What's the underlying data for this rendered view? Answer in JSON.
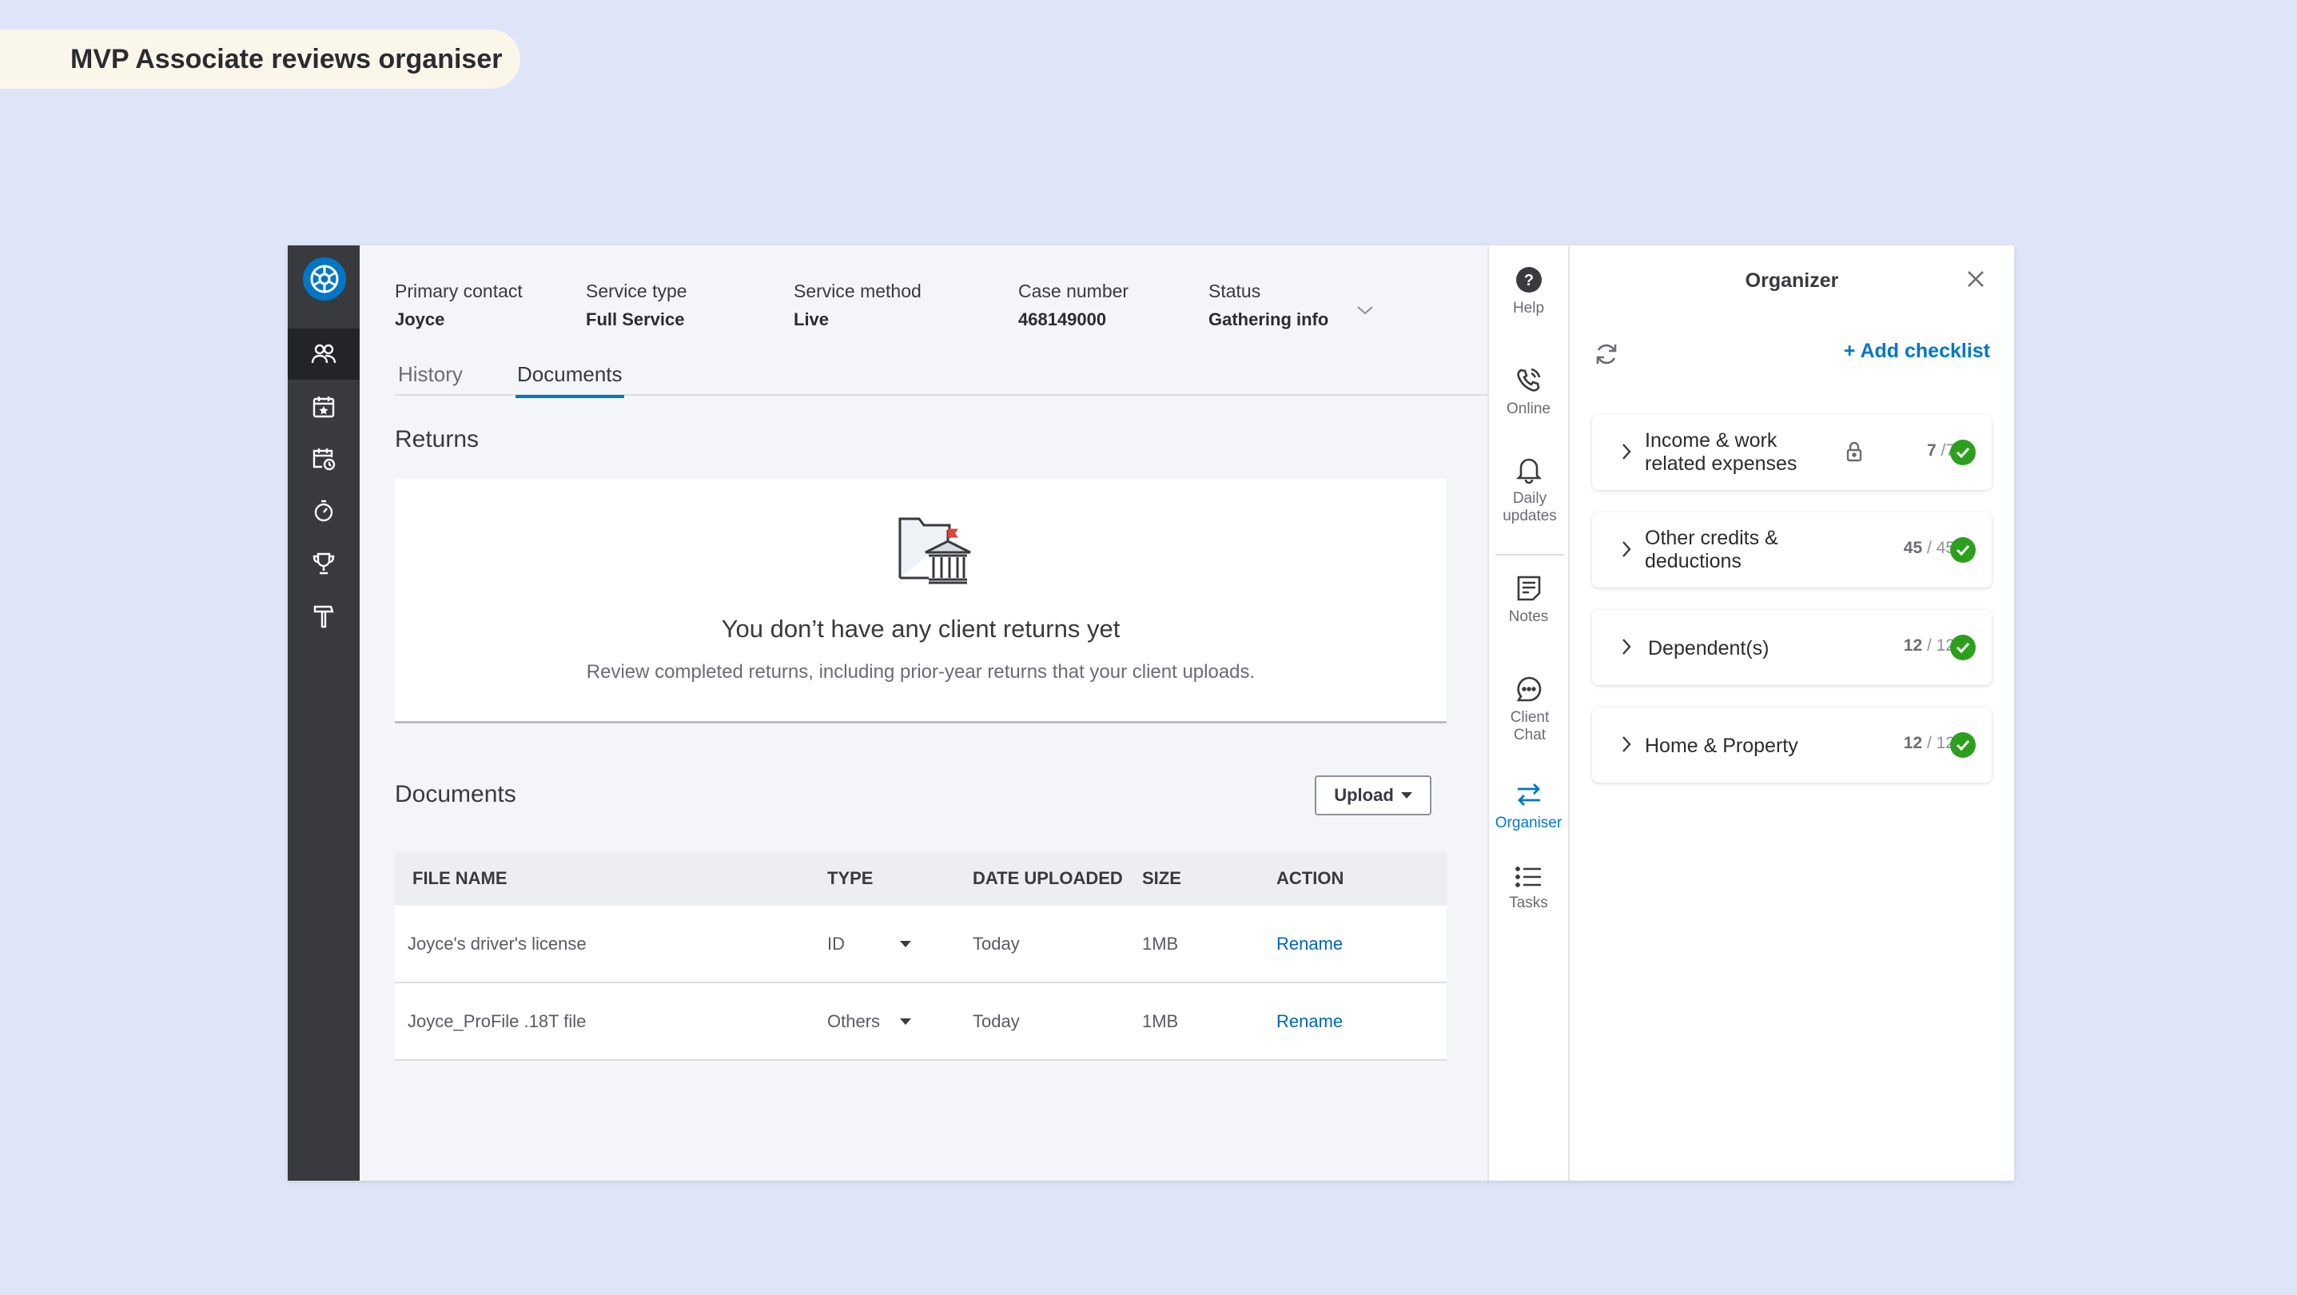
{
  "page_label": "MVP Associate reviews organiser",
  "header": {
    "primary_contact": {
      "label": "Primary contact",
      "value": "Joyce"
    },
    "service_type": {
      "label": "Service type",
      "value": "Full Service"
    },
    "service_method": {
      "label": "Service method",
      "value": "Live"
    },
    "case_number": {
      "label": "Case number",
      "value": "468149000"
    },
    "status": {
      "label": "Status",
      "value": "Gathering info"
    }
  },
  "tabs": [
    {
      "label": "History",
      "active": false
    },
    {
      "label": "Documents",
      "active": true
    }
  ],
  "returns": {
    "title": "Returns",
    "empty_heading": "You don’t have any client returns yet",
    "empty_sub": "Review completed returns, including prior-year returns that your client uploads."
  },
  "documents": {
    "title": "Documents",
    "upload_label": "Upload",
    "columns": [
      "FILE NAME",
      "TYPE",
      "DATE UPLOADED",
      "SIZE",
      "ACTION"
    ],
    "rows": [
      {
        "file": "Joyce's driver's license",
        "type": "ID",
        "date": "Today",
        "size": "1MB",
        "action": "Rename"
      },
      {
        "file": "Joyce_ProFile .18T file",
        "type": "Others",
        "date": "Today",
        "size": "1MB",
        "action": "Rename"
      }
    ]
  },
  "rail": {
    "help": "Help",
    "online": "Online",
    "daily_updates": "Daily updates",
    "notes": "Notes",
    "client_chat": "Client Chat",
    "organiser": "Organiser",
    "tasks": "Tasks"
  },
  "organizer": {
    "title": "Organizer",
    "add_checklist": "+ Add checklist",
    "checklists": [
      {
        "title": "Income & work related expenses",
        "done": "7",
        "total": "/7",
        "locked": true
      },
      {
        "title": "Other credits & deductions",
        "done": "45",
        "total": " / 45",
        "locked": false
      },
      {
        "title": "Dependent(s)",
        "done": "12",
        "total": " / 12",
        "locked": false
      },
      {
        "title": "Home & Property",
        "done": "12",
        "total": " / 12",
        "locked": false
      }
    ]
  },
  "colors": {
    "background": "#dfe5f8",
    "accent": "#0077c5",
    "left_nav": "#393a3d",
    "success": "#2ca01c"
  },
  "icons": {
    "left_nav": [
      "logo-icon",
      "clients-icon",
      "calendar-star-icon",
      "calendar-clock-icon",
      "stopwatch-icon",
      "trophy-icon",
      "hammer-icon"
    ]
  }
}
